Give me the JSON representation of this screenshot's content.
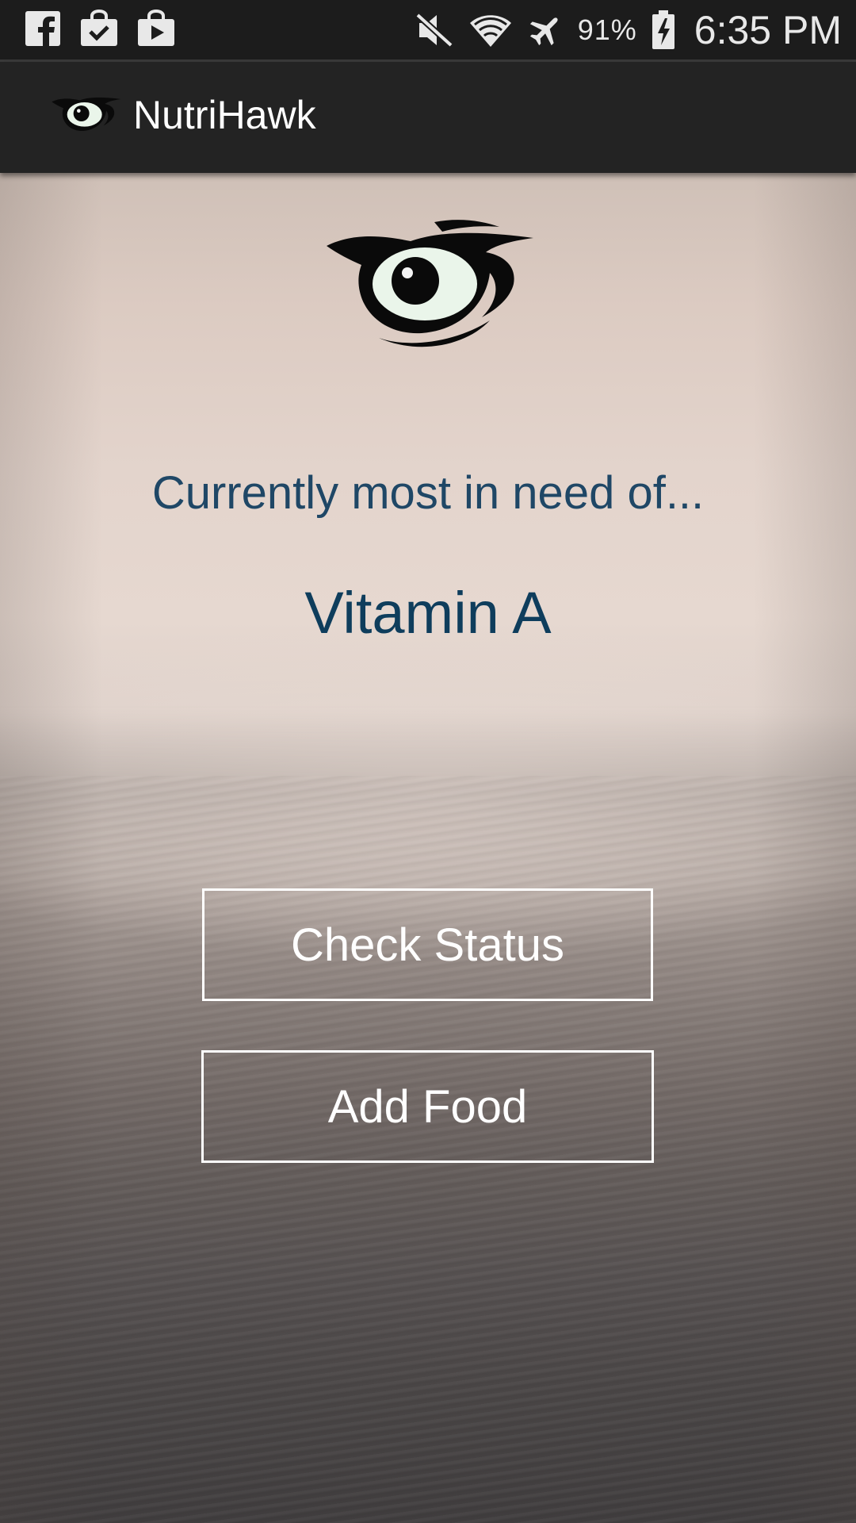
{
  "status_bar": {
    "left_icons": [
      "facebook-icon",
      "shopping-bag-check-icon",
      "play-store-icon"
    ],
    "right_icons": [
      "mute-icon",
      "wifi-icon",
      "airplane-mode-icon",
      "battery-charging-icon"
    ],
    "battery_percent": "91%",
    "time": "6:35 PM"
  },
  "action_bar": {
    "icon": "hawk-eye-logo-icon",
    "title": "NutriHawk"
  },
  "main": {
    "logo": "hawk-eye-logo-icon",
    "need_heading": "Currently most in need of...",
    "nutrient": "Vitamin A",
    "check_status_label": "Check Status",
    "add_food_label": "Add Food"
  },
  "colors": {
    "heading_text": "#1f4766",
    "nutrient_text": "#0e3d5c",
    "button_border": "#ffffff",
    "action_bar_bg": "#232323",
    "status_bar_bg": "#1c1c1c"
  }
}
